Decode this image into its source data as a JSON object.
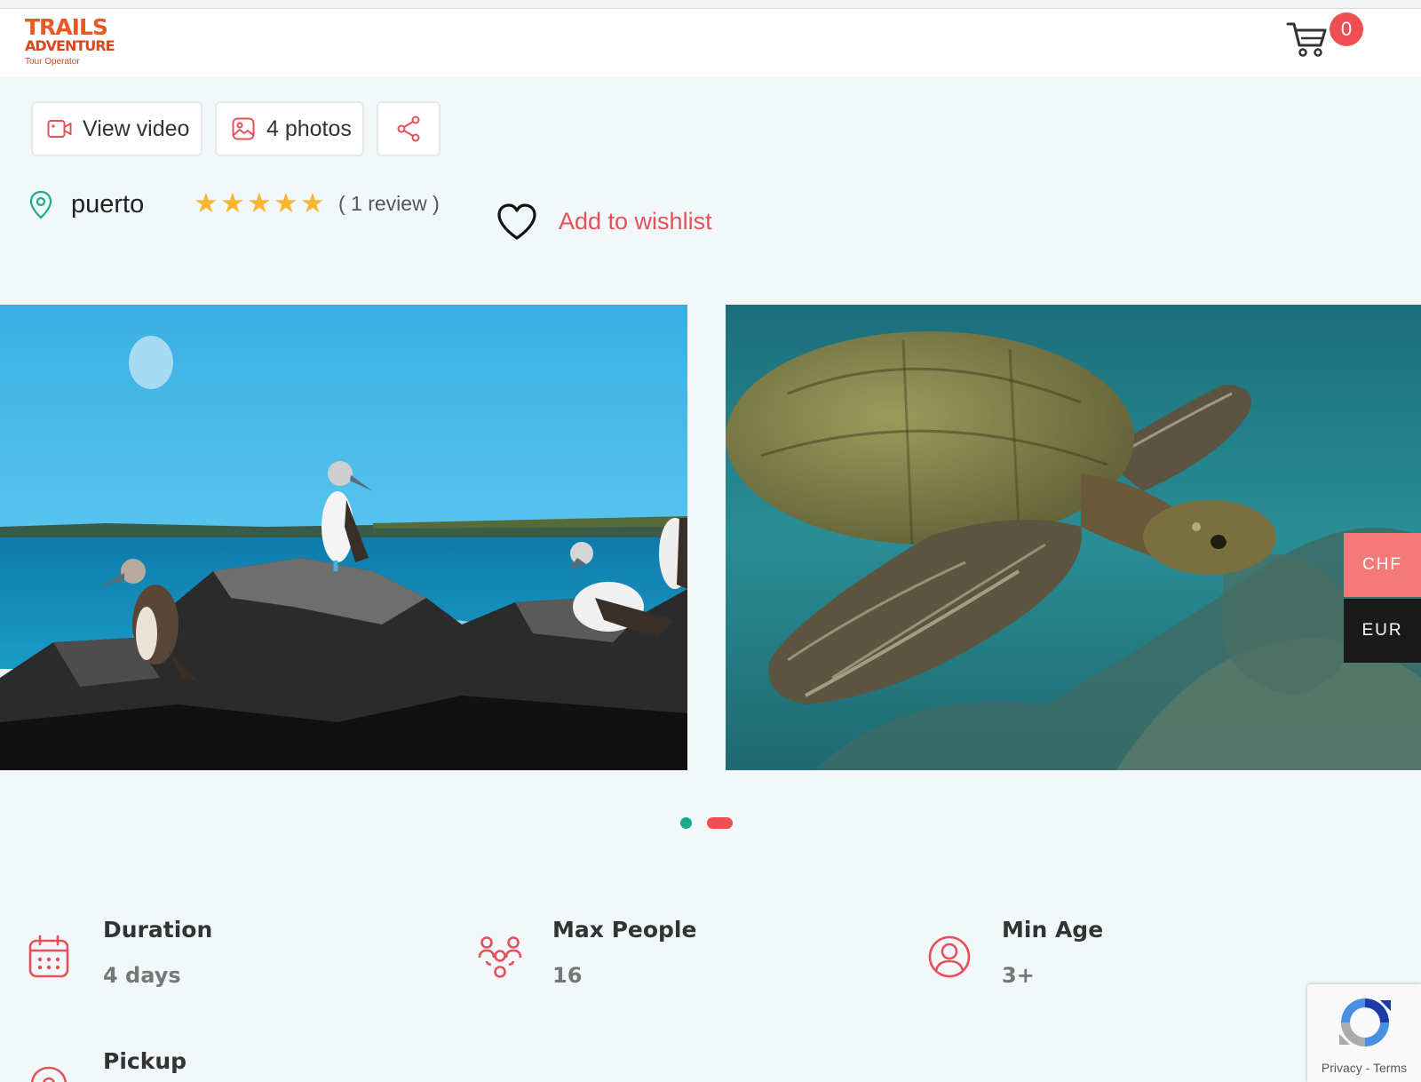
{
  "header": {
    "logo": {
      "line1": "TRAILS",
      "line2": "ADVENTURE",
      "line3": "Tour Operator"
    },
    "cart_icon": "cart-icon",
    "cart_count": "0"
  },
  "actions": {
    "view_video": "View video",
    "photos": "4 photos",
    "share_icon": "share-icon"
  },
  "tour": {
    "location": "puerto",
    "rating_stars": 5,
    "review_text": "( 1 review )",
    "wishlist_label": "Add to wishlist"
  },
  "gallery": {
    "slides": [
      "blue-footed-boobies-on-rocks",
      "sea-turtle-underwater"
    ],
    "active_dot": 2,
    "dot_count": 2
  },
  "currency": {
    "options": [
      "CHF",
      "EUR"
    ]
  },
  "details": [
    {
      "label": "Duration",
      "value": "4 days",
      "icon": "calendar-icon"
    },
    {
      "label": "Max People",
      "value": "16",
      "icon": "group-icon"
    },
    {
      "label": "Min Age",
      "value": "3+",
      "icon": "user-icon"
    },
    {
      "label": "Pickup",
      "value": "",
      "icon": "location-icon"
    }
  ],
  "recaptcha": {
    "links": "Privacy - Terms"
  },
  "colors": {
    "accent": "#ef4e52",
    "teal": "#1aaa8e",
    "star": "#f7b731",
    "logo": "#e85a24"
  }
}
